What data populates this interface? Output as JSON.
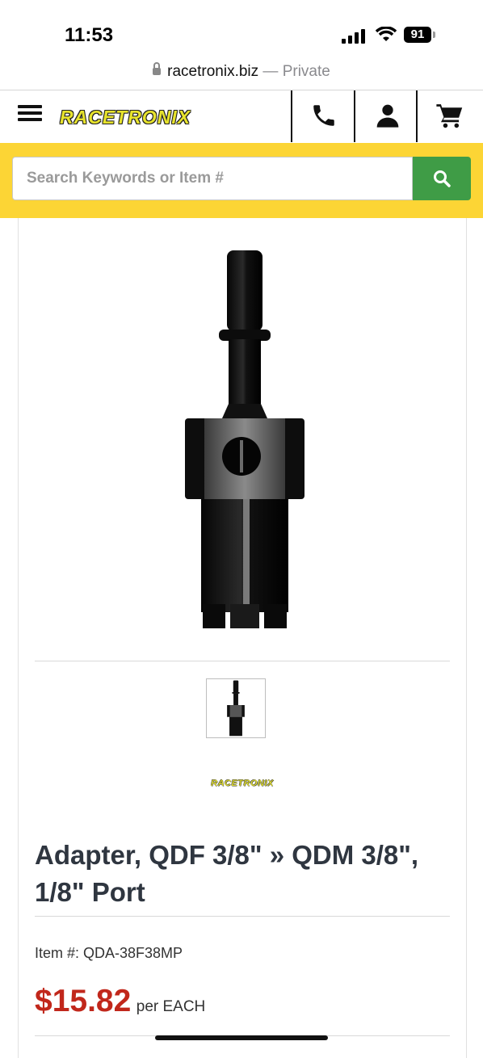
{
  "status_bar": {
    "time": "11:53",
    "battery": "91"
  },
  "browser": {
    "domain": "racetronix.biz",
    "separator": "—",
    "mode": "Private"
  },
  "header": {
    "logo_text": "RACETRONIX",
    "icons": [
      "menu-icon",
      "phone-icon",
      "account-icon",
      "cart-icon"
    ]
  },
  "search": {
    "placeholder": "Search Keywords or Item #",
    "value": "",
    "button_icon": "search-icon"
  },
  "product": {
    "brand_logo_text": "RACETRONIX",
    "title": "Adapter, QDF 3/8\" » QDM 3/8\", 1/8\" Port",
    "item_label": "Item #: QDA-38F38MP",
    "price": "$15.82",
    "price_unit": "per EACH"
  },
  "colors": {
    "search_band": "#fcd535",
    "search_button": "#3f9c46",
    "price": "#c1271b",
    "logo": "#e7e32c"
  }
}
